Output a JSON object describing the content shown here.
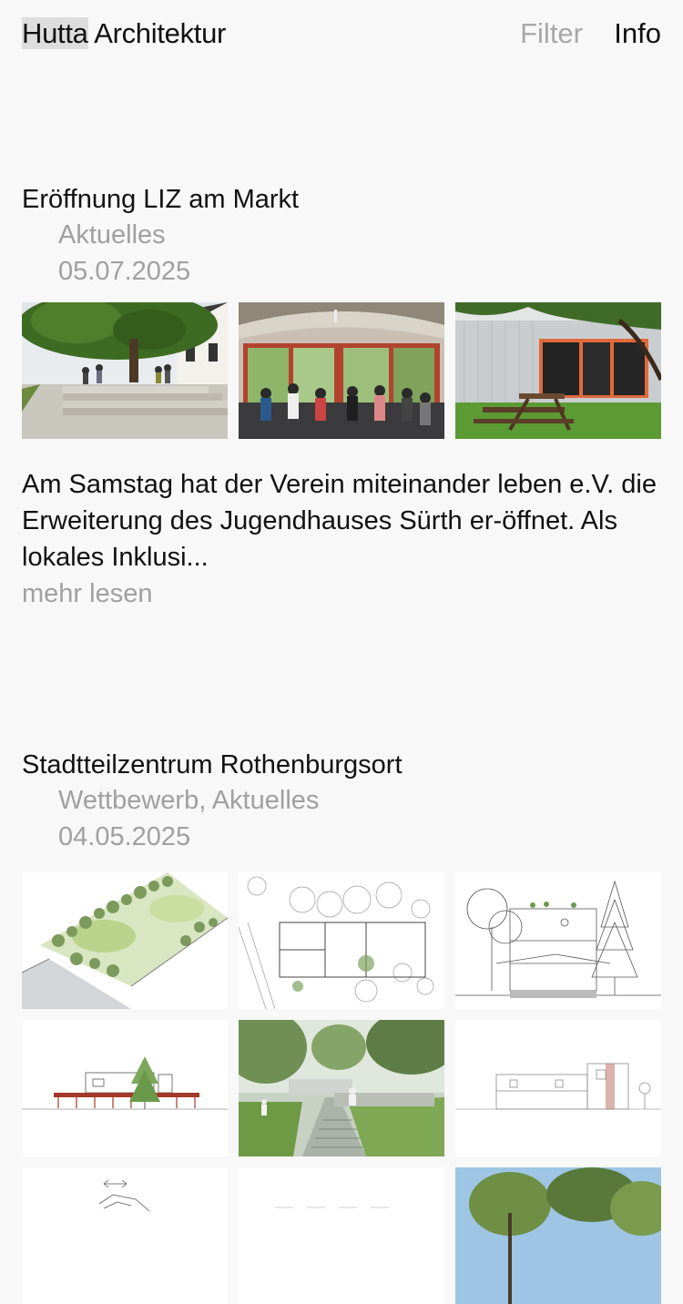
{
  "header": {
    "brand_first": "Hutta",
    "brand_second": " Architektur",
    "filter_label": "Filter",
    "info_label": "Info"
  },
  "posts": [
    {
      "title": "Eröffnung LIZ am Markt",
      "category": "Aktuelles",
      "date": "05.07.2025",
      "images": [
        "photo-tree-courtyard-steps",
        "photo-interior-vaulted-hall-crowd",
        "photo-facade-picnic-table"
      ],
      "excerpt": "Am Samstag hat der Verein miteinander leben e.V. die Erweiterung des Jugendhauses Sürth er-öffnet. Als lokales Inklusi...",
      "more_label": "mehr lesen"
    },
    {
      "title": "Stadtteilzentrum Rothenburgsort",
      "category": "Wettbewerb, Aktuelles",
      "date": "04.05.2025",
      "images": [
        "drawing-site-plan-axonometric",
        "drawing-floor-plan",
        "drawing-section-trees",
        "drawing-elevation",
        "render-garden-path",
        "drawing-section-building",
        "drawing-sketch",
        "drawing-plan-faint",
        "render-trees-sky"
      ]
    }
  ],
  "colors": {
    "background": "#f8f8f8",
    "text": "#111111",
    "muted": "#a0a0a0",
    "brand_highlight": "#dddddd"
  }
}
